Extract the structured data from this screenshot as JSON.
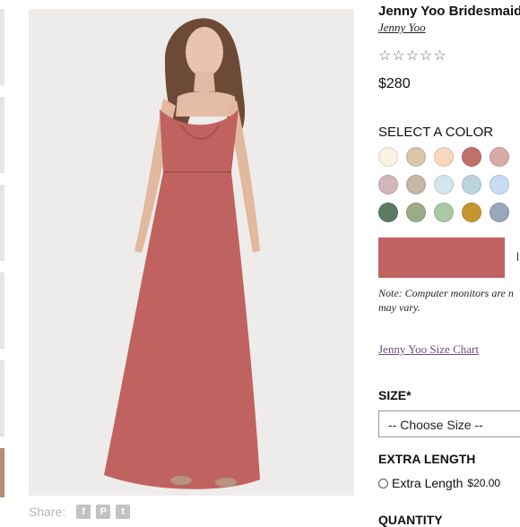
{
  "product": {
    "title": "Jenny Yoo Bridesmaid I",
    "brand": "Jenny Yoo",
    "rating_stars": "☆☆☆☆☆",
    "rating_value": 0,
    "price": "$280"
  },
  "colors": {
    "heading": "SELECT A COLOR",
    "swatches": [
      {
        "name": "ivory",
        "hex": "#f8f1e4"
      },
      {
        "name": "sand",
        "hex": "#d8c7a8"
      },
      {
        "name": "peach",
        "hex": "#f8d7bf"
      },
      {
        "name": "desert-rose",
        "hex": "#c0706a"
      },
      {
        "name": "dusty-rose",
        "hex": "#d9aaa8"
      },
      {
        "name": "mauve",
        "hex": "#d3b7b8"
      },
      {
        "name": "taupe",
        "hex": "#c6b8a5"
      },
      {
        "name": "powder-blue",
        "hex": "#d2e6ec"
      },
      {
        "name": "mist-blue",
        "hex": "#bcd4dc"
      },
      {
        "name": "sky-blue",
        "hex": "#c7dbf1"
      },
      {
        "name": "forest",
        "hex": "#5d7a63"
      },
      {
        "name": "sage",
        "hex": "#9cab88"
      },
      {
        "name": "mint",
        "hex": "#a9c9a5"
      },
      {
        "name": "mustard",
        "hex": "#c7952f"
      },
      {
        "name": "slate",
        "hex": "#9aa6b9"
      }
    ],
    "selected_hex": "#c0625f"
  },
  "add_button_letter": "l",
  "note_lines": [
    "Note: Computer monitors are n",
    "may vary."
  ],
  "size_chart_link": "Jenny Yoo Size Chart",
  "size": {
    "heading": "SIZE*",
    "selected": "-- Choose Size --"
  },
  "extra_length": {
    "heading": "EXTRA LENGTH",
    "option_label": "Extra Length",
    "option_price": "$20.00"
  },
  "quantity": {
    "heading": "QUANTITY"
  },
  "share": {
    "label": "Share:",
    "icons": [
      "facebook-icon",
      "pinterest-icon",
      "twitter-icon"
    ]
  }
}
